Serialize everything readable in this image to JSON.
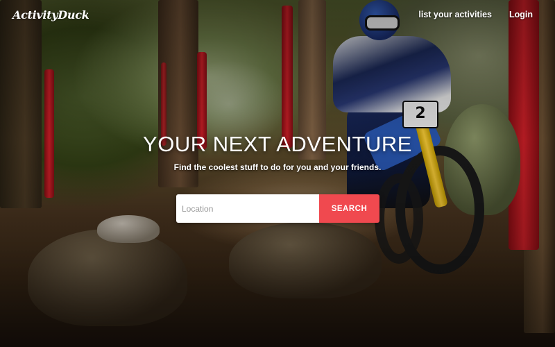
{
  "header": {
    "logo_text": "ActivityDuck",
    "nav": [
      {
        "label": "list your activities"
      },
      {
        "label": "Login"
      }
    ]
  },
  "hero": {
    "title": "YOUR NEXT ADVENTURE",
    "subtitle": "Find the coolest stuff to do for you and your friends.",
    "background_image": "mountain-bike-rider-forest-trail-photo",
    "rider_plate_number": "2"
  },
  "search": {
    "placeholder": "Location",
    "value": "",
    "button_label": "SEARCH"
  },
  "colors": {
    "accent": "#f0494f",
    "text": "#ffffff",
    "input_bg": "#ffffff"
  }
}
